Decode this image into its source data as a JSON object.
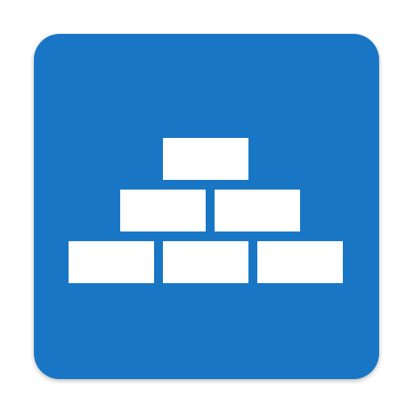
{
  "icon": {
    "name": "stacked-bricks",
    "background_color": "#1976c5",
    "brick_color": "#ffffff",
    "rows": [
      1,
      2,
      3
    ]
  }
}
